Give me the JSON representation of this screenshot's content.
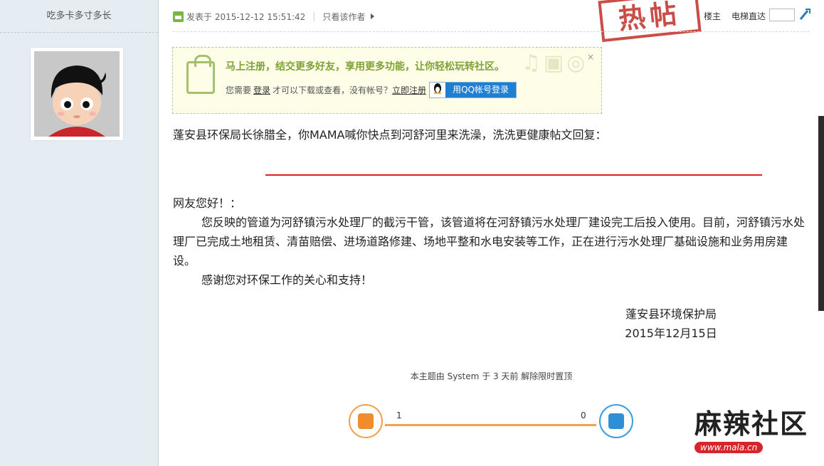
{
  "author": {
    "name": "吃多卡多寸多长"
  },
  "post_header": {
    "posted_prefix": "发表于 2015-12-12 15:51:42",
    "only_author": "只看该作者",
    "stamp": "热帖",
    "floor": "楼主",
    "elevator": "电梯直达"
  },
  "notice": {
    "title": "马上注册，结交更多好友，享用更多功能，让你轻松玩转社区。",
    "text_before": "您需要",
    "login_link": "登录",
    "text_middle": "才可以下载或查看，没有帐号？",
    "register_link": "立即注册",
    "qq_button": "用QQ帐号登录",
    "close": "×"
  },
  "content": {
    "reply_title": "蓬安县环保局长徐腊全，你MAMA喊你快点到河舒河里来洗澡，洗洗更健康帖文回复：",
    "greeting": "网友您好！：",
    "paragraph1": "您反映的管道为河舒镇污水处理厂的截污干管，该管道将在河舒镇污水处理厂建设完工后投入使用。目前，河舒镇污水处理厂已完成土地租赁、清苗赔偿、进场道路修建、场地平整和水电安装等工作，正在进行污水处理厂基础设施和业务用房建设。",
    "paragraph2": "感谢您对环保工作的关心和支持！",
    "sign_org": "蓬安县环境保护局",
    "sign_date": "2015年12月15日"
  },
  "system_note": "本主题由 System 于 3 天前 解除限时置顶",
  "vote": {
    "up_count": "1",
    "down_count": "0",
    "up_share": 1.0
  },
  "watermark": {
    "logo": "麻辣社区",
    "url": "www.mala.cn"
  }
}
